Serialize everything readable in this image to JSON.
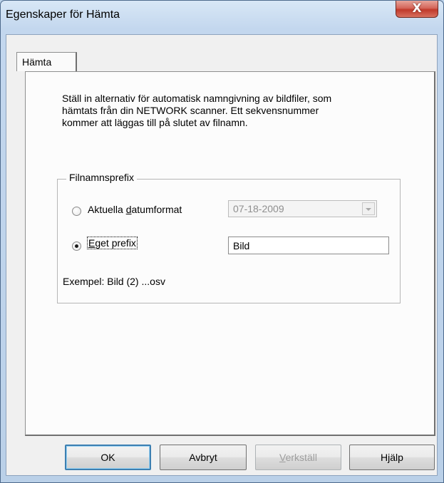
{
  "window": {
    "title": "Egenskaper för Hämta",
    "close_glyph": "X"
  },
  "tabs": [
    {
      "label": "Hämta",
      "selected": true
    }
  ],
  "description": "Ställ in alternativ för automatisk namngivning av bildfiler, som\nhämtats från din NETWORK scanner. Ett sekvensnummer\nkommer att läggas till på slutet av filnamn.",
  "prefix_group": {
    "label": "Filnamnsprefix",
    "date_option": {
      "label_pre": "Aktuella ",
      "label_access": "d",
      "label_post": "atumformat",
      "selected": false,
      "value": "07-18-2009"
    },
    "custom_option": {
      "label_access": "E",
      "label_post": "get prefix",
      "selected": true,
      "value": "Bild"
    },
    "example": "Exempel: Bild (2) ...osv"
  },
  "buttons": {
    "ok": "OK",
    "cancel": "Avbryt",
    "apply_access": "V",
    "apply_rest": "erkställ",
    "help": "Hjälp"
  },
  "icons": {
    "close": "close-icon",
    "dropdown": "chevron-down-icon",
    "radio": "radio-button-icon"
  },
  "colors": {
    "title_bar": "#c3d7ee",
    "close_button": "#c0392b",
    "dialog_bg": "#f0f0f0",
    "default_button_border": "#3c7fb1",
    "disabled_text": "#9d9d9d"
  }
}
